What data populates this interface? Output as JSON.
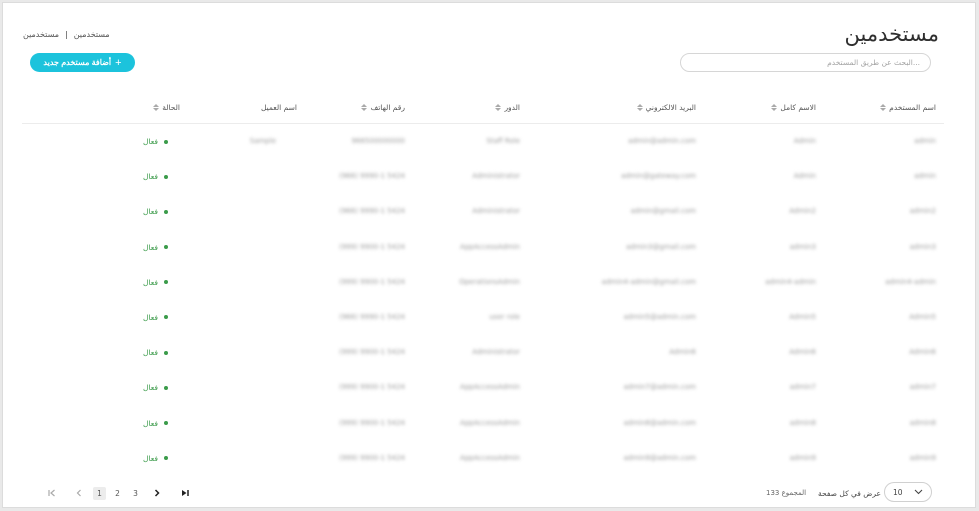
{
  "page": {
    "title": "مستخدمين",
    "breadcrumb": [
      "مستخدمين",
      "مستخدمين"
    ]
  },
  "actions": {
    "add_user_label": "أضافة مستخدم جديد"
  },
  "search": {
    "placeholder": "...البحث عن طريق المستخدم"
  },
  "table": {
    "columns": [
      "اسم المستخدم",
      "الاسم كامل",
      "البريد الالكتروني",
      "الدور",
      "رقم الهاتف",
      "اسم العميل",
      "الحالة"
    ],
    "rows": [
      {
        "username": "admin",
        "fullname": "Admin",
        "email": "admin@admin.com",
        "role": "Staff Role",
        "phone": "966500000000",
        "client": "Sample",
        "status": "فعال"
      },
      {
        "username": "admin",
        "fullname": "Admin",
        "email": "admin@gateway.com",
        "role": "Administrator",
        "phone": "(966) 9990-1 5424",
        "client": "",
        "status": "فعال"
      },
      {
        "username": "admin2",
        "fullname": "Admin2",
        "email": "admin@gmail.com",
        "role": "Administrator",
        "phone": "(966) 9990-1 5424",
        "client": "",
        "status": "فعال"
      },
      {
        "username": "admin3",
        "fullname": "admin3",
        "email": "admin3@gmail.com",
        "role": "AppAccessAdmin",
        "phone": "(999) 9900-1 5424",
        "client": "",
        "status": "فعال"
      },
      {
        "username": "admin4-admin",
        "fullname": "admin4-admin",
        "email": "admin4-admin@gmail.com",
        "role": "OperationsAdmin",
        "phone": "(999) 9900-1 5424",
        "client": "",
        "status": "فعال"
      },
      {
        "username": "Admin5",
        "fullname": "Admin5",
        "email": "admin5@admin.com",
        "role": "user role",
        "phone": "(966) 9990-1 5424",
        "client": "",
        "status": "فعال"
      },
      {
        "username": "Admin6",
        "fullname": "Admin6",
        "email": "Admin6",
        "role": "Administrator",
        "phone": "(999) 9900-1 5424",
        "client": "",
        "status": "فعال"
      },
      {
        "username": "admin7",
        "fullname": "admin7",
        "email": "admin7@admin.com",
        "role": "AppAccessAdmin",
        "phone": "(999) 9900-1 5424",
        "client": "",
        "status": "فعال"
      },
      {
        "username": "admin8",
        "fullname": "admin8",
        "email": "admin8@admin.com",
        "role": "AppAccessAdmin",
        "phone": "(999) 9900-1 5424",
        "client": "",
        "status": "فعال"
      },
      {
        "username": "admin9",
        "fullname": "admin9",
        "email": "admin9@admin.com",
        "role": "AppAccessAdmin",
        "phone": "(999) 9900-1 5424",
        "client": "",
        "status": "فعال"
      }
    ]
  },
  "pagination": {
    "pages": [
      "1",
      "2",
      "3"
    ],
    "current": "1",
    "total_label": "المجموع 133",
    "per_page_label": "عرض في كل صفحة",
    "per_page_value": "10"
  },
  "colors": {
    "accent": "#1cc3dc",
    "active_status": "#3b9b4a"
  }
}
